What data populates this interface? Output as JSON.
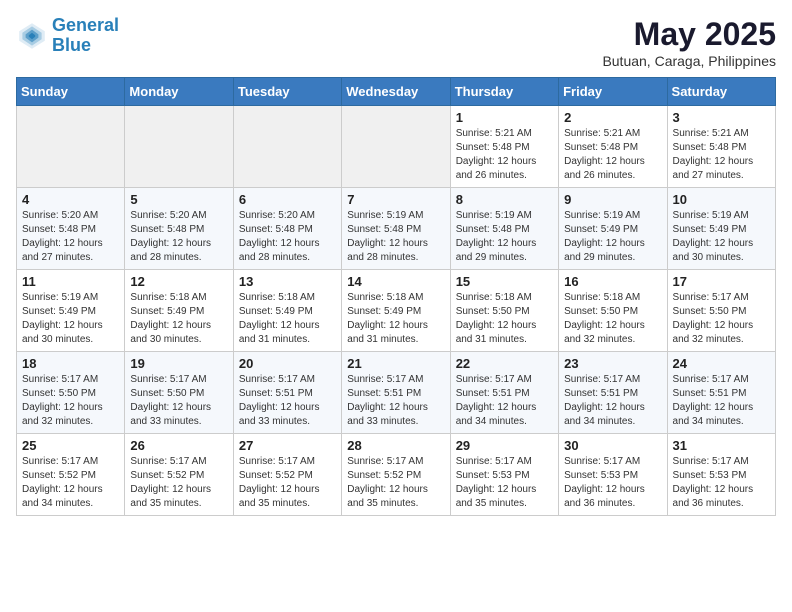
{
  "header": {
    "logo_line1": "General",
    "logo_line2": "Blue",
    "main_title": "May 2025",
    "subtitle": "Butuan, Caraga, Philippines"
  },
  "days_of_week": [
    "Sunday",
    "Monday",
    "Tuesday",
    "Wednesday",
    "Thursday",
    "Friday",
    "Saturday"
  ],
  "weeks": [
    [
      {
        "day": "",
        "sunrise": "",
        "sunset": "",
        "daylight": "",
        "empty": true
      },
      {
        "day": "",
        "sunrise": "",
        "sunset": "",
        "daylight": "",
        "empty": true
      },
      {
        "day": "",
        "sunrise": "",
        "sunset": "",
        "daylight": "",
        "empty": true
      },
      {
        "day": "",
        "sunrise": "",
        "sunset": "",
        "daylight": "",
        "empty": true
      },
      {
        "day": "1",
        "sunrise": "Sunrise: 5:21 AM",
        "sunset": "Sunset: 5:48 PM",
        "daylight": "Daylight: 12 hours and 26 minutes."
      },
      {
        "day": "2",
        "sunrise": "Sunrise: 5:21 AM",
        "sunset": "Sunset: 5:48 PM",
        "daylight": "Daylight: 12 hours and 26 minutes."
      },
      {
        "day": "3",
        "sunrise": "Sunrise: 5:21 AM",
        "sunset": "Sunset: 5:48 PM",
        "daylight": "Daylight: 12 hours and 27 minutes."
      }
    ],
    [
      {
        "day": "4",
        "sunrise": "Sunrise: 5:20 AM",
        "sunset": "Sunset: 5:48 PM",
        "daylight": "Daylight: 12 hours and 27 minutes."
      },
      {
        "day": "5",
        "sunrise": "Sunrise: 5:20 AM",
        "sunset": "Sunset: 5:48 PM",
        "daylight": "Daylight: 12 hours and 28 minutes."
      },
      {
        "day": "6",
        "sunrise": "Sunrise: 5:20 AM",
        "sunset": "Sunset: 5:48 PM",
        "daylight": "Daylight: 12 hours and 28 minutes."
      },
      {
        "day": "7",
        "sunrise": "Sunrise: 5:19 AM",
        "sunset": "Sunset: 5:48 PM",
        "daylight": "Daylight: 12 hours and 28 minutes."
      },
      {
        "day": "8",
        "sunrise": "Sunrise: 5:19 AM",
        "sunset": "Sunset: 5:48 PM",
        "daylight": "Daylight: 12 hours and 29 minutes."
      },
      {
        "day": "9",
        "sunrise": "Sunrise: 5:19 AM",
        "sunset": "Sunset: 5:49 PM",
        "daylight": "Daylight: 12 hours and 29 minutes."
      },
      {
        "day": "10",
        "sunrise": "Sunrise: 5:19 AM",
        "sunset": "Sunset: 5:49 PM",
        "daylight": "Daylight: 12 hours and 30 minutes."
      }
    ],
    [
      {
        "day": "11",
        "sunrise": "Sunrise: 5:19 AM",
        "sunset": "Sunset: 5:49 PM",
        "daylight": "Daylight: 12 hours and 30 minutes."
      },
      {
        "day": "12",
        "sunrise": "Sunrise: 5:18 AM",
        "sunset": "Sunset: 5:49 PM",
        "daylight": "Daylight: 12 hours and 30 minutes."
      },
      {
        "day": "13",
        "sunrise": "Sunrise: 5:18 AM",
        "sunset": "Sunset: 5:49 PM",
        "daylight": "Daylight: 12 hours and 31 minutes."
      },
      {
        "day": "14",
        "sunrise": "Sunrise: 5:18 AM",
        "sunset": "Sunset: 5:49 PM",
        "daylight": "Daylight: 12 hours and 31 minutes."
      },
      {
        "day": "15",
        "sunrise": "Sunrise: 5:18 AM",
        "sunset": "Sunset: 5:50 PM",
        "daylight": "Daylight: 12 hours and 31 minutes."
      },
      {
        "day": "16",
        "sunrise": "Sunrise: 5:18 AM",
        "sunset": "Sunset: 5:50 PM",
        "daylight": "Daylight: 12 hours and 32 minutes."
      },
      {
        "day": "17",
        "sunrise": "Sunrise: 5:17 AM",
        "sunset": "Sunset: 5:50 PM",
        "daylight": "Daylight: 12 hours and 32 minutes."
      }
    ],
    [
      {
        "day": "18",
        "sunrise": "Sunrise: 5:17 AM",
        "sunset": "Sunset: 5:50 PM",
        "daylight": "Daylight: 12 hours and 32 minutes."
      },
      {
        "day": "19",
        "sunrise": "Sunrise: 5:17 AM",
        "sunset": "Sunset: 5:50 PM",
        "daylight": "Daylight: 12 hours and 33 minutes."
      },
      {
        "day": "20",
        "sunrise": "Sunrise: 5:17 AM",
        "sunset": "Sunset: 5:51 PM",
        "daylight": "Daylight: 12 hours and 33 minutes."
      },
      {
        "day": "21",
        "sunrise": "Sunrise: 5:17 AM",
        "sunset": "Sunset: 5:51 PM",
        "daylight": "Daylight: 12 hours and 33 minutes."
      },
      {
        "day": "22",
        "sunrise": "Sunrise: 5:17 AM",
        "sunset": "Sunset: 5:51 PM",
        "daylight": "Daylight: 12 hours and 34 minutes."
      },
      {
        "day": "23",
        "sunrise": "Sunrise: 5:17 AM",
        "sunset": "Sunset: 5:51 PM",
        "daylight": "Daylight: 12 hours and 34 minutes."
      },
      {
        "day": "24",
        "sunrise": "Sunrise: 5:17 AM",
        "sunset": "Sunset: 5:51 PM",
        "daylight": "Daylight: 12 hours and 34 minutes."
      }
    ],
    [
      {
        "day": "25",
        "sunrise": "Sunrise: 5:17 AM",
        "sunset": "Sunset: 5:52 PM",
        "daylight": "Daylight: 12 hours and 34 minutes."
      },
      {
        "day": "26",
        "sunrise": "Sunrise: 5:17 AM",
        "sunset": "Sunset: 5:52 PM",
        "daylight": "Daylight: 12 hours and 35 minutes."
      },
      {
        "day": "27",
        "sunrise": "Sunrise: 5:17 AM",
        "sunset": "Sunset: 5:52 PM",
        "daylight": "Daylight: 12 hours and 35 minutes."
      },
      {
        "day": "28",
        "sunrise": "Sunrise: 5:17 AM",
        "sunset": "Sunset: 5:52 PM",
        "daylight": "Daylight: 12 hours and 35 minutes."
      },
      {
        "day": "29",
        "sunrise": "Sunrise: 5:17 AM",
        "sunset": "Sunset: 5:53 PM",
        "daylight": "Daylight: 12 hours and 35 minutes."
      },
      {
        "day": "30",
        "sunrise": "Sunrise: 5:17 AM",
        "sunset": "Sunset: 5:53 PM",
        "daylight": "Daylight: 12 hours and 36 minutes."
      },
      {
        "day": "31",
        "sunrise": "Sunrise: 5:17 AM",
        "sunset": "Sunset: 5:53 PM",
        "daylight": "Daylight: 12 hours and 36 minutes."
      }
    ]
  ]
}
